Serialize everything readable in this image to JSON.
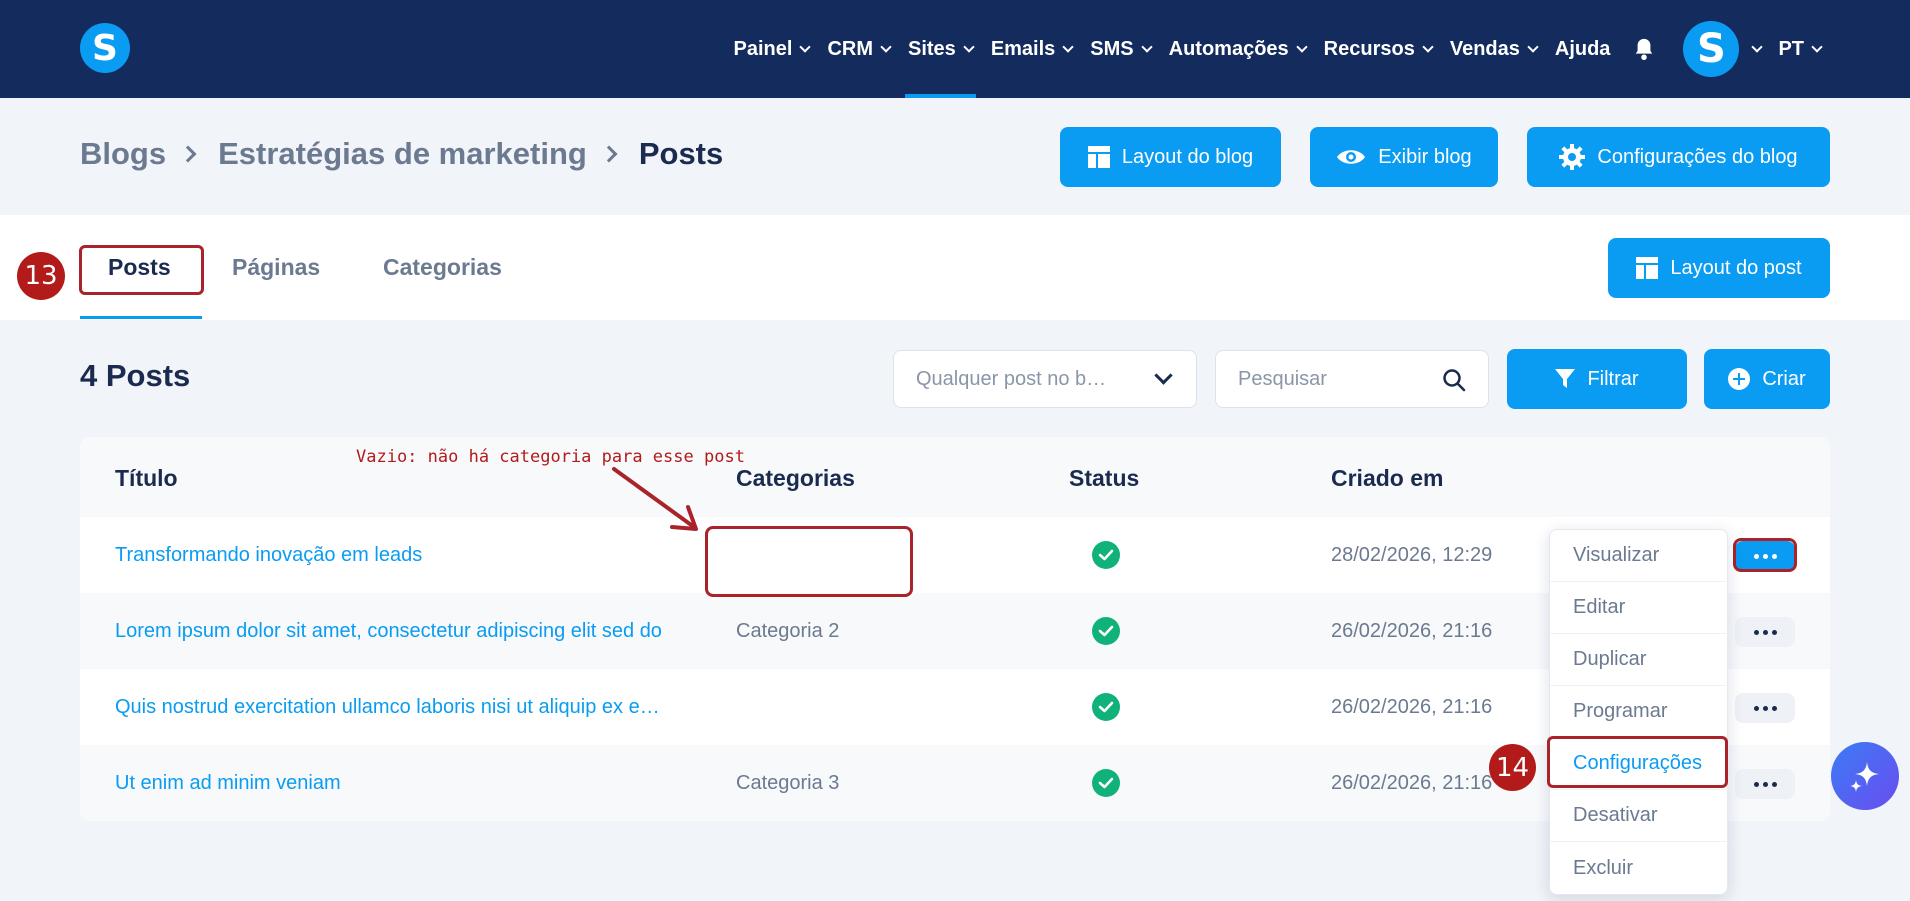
{
  "nav": {
    "items": [
      {
        "label": "Painel",
        "has_menu": true,
        "active": false
      },
      {
        "label": "CRM",
        "has_menu": true,
        "active": false
      },
      {
        "label": "Sites",
        "has_menu": true,
        "active": true
      },
      {
        "label": "Emails",
        "has_menu": true,
        "active": false
      },
      {
        "label": "SMS",
        "has_menu": true,
        "active": false
      },
      {
        "label": "Automações",
        "has_menu": true,
        "active": false
      },
      {
        "label": "Recursos",
        "has_menu": true,
        "active": false
      },
      {
        "label": "Vendas",
        "has_menu": true,
        "active": false
      },
      {
        "label": "Ajuda",
        "has_menu": false,
        "active": false
      }
    ],
    "language": "PT",
    "logo_letter": "S",
    "avatar_letter": "S"
  },
  "breadcrumb": {
    "items": [
      "Blogs",
      "Estratégias de marketing",
      "Posts"
    ]
  },
  "header_buttons": {
    "layout_blog": "Layout do blog",
    "view_blog": "Exibir blog",
    "blog_settings": "Configurações do blog"
  },
  "tabs": {
    "posts": "Posts",
    "pages": "Páginas",
    "categories": "Categorias",
    "layout_post": "Layout do post"
  },
  "toolbar": {
    "count_title": "4 Posts",
    "select_value": "Qualquer post no b…",
    "search_placeholder": "Pesquisar",
    "filter_label": "Filtrar",
    "create_label": "Criar"
  },
  "table": {
    "columns": [
      "Título",
      "Categorias",
      "Status",
      "Criado em"
    ],
    "rows": [
      {
        "title": "Transformando inovação em leads",
        "category": "",
        "status": "published",
        "created": "28/02/2026, 12:29"
      },
      {
        "title": "Lorem ipsum dolor sit amet, consectetur adipiscing elit sed do",
        "category": "Categoria 2",
        "status": "published",
        "created": "26/02/2026, 21:16"
      },
      {
        "title": "Quis nostrud exercitation ullamco laboris nisi ut aliquip ex e…",
        "category": "",
        "status": "published",
        "created": "26/02/2026, 21:16"
      },
      {
        "title": "Ut enim ad minim veniam",
        "category": "Categoria 3",
        "status": "published",
        "created": "26/02/2026, 21:16"
      }
    ]
  },
  "row_menu": {
    "items": [
      "Visualizar",
      "Editar",
      "Duplicar",
      "Programar",
      "Configurações",
      "Desativar",
      "Excluir"
    ],
    "highlighted": "Configurações"
  },
  "annotations": {
    "step_13": "13",
    "step_14": "14",
    "note": "Vazio: não há categoria para esse post",
    "color": "#b31b1b"
  },
  "colors": {
    "nav_bg": "#142b5e",
    "accent": "#0a9cf2",
    "success": "#10b27a"
  },
  "icons": [
    "bell-icon",
    "layout-icon",
    "eye-icon",
    "gear-icon",
    "filter-icon",
    "plus-circle-icon",
    "search-icon",
    "check-icon",
    "more-icon",
    "sparkle-icon"
  ]
}
